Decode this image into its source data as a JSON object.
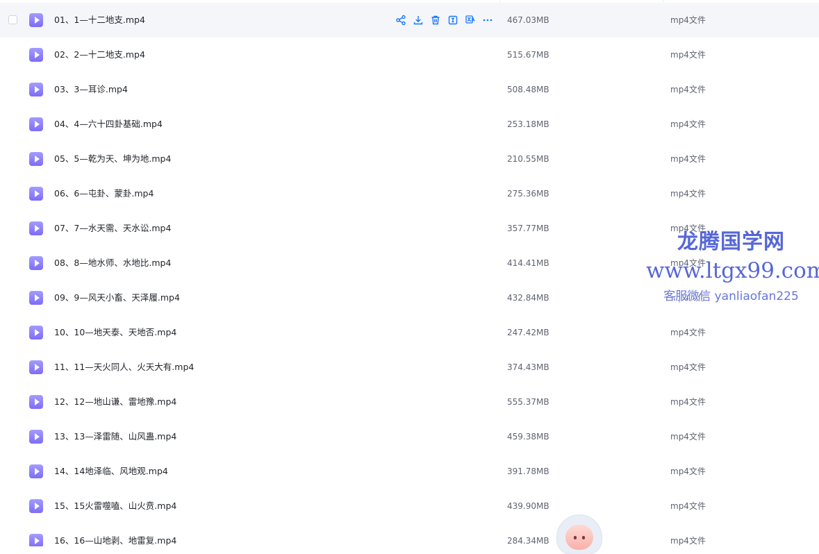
{
  "files": [
    {
      "name": "01、1—十二地支.mp4",
      "size": "467.03MB",
      "type": "mp4文件",
      "hovered": true
    },
    {
      "name": "02、2—十二地支.mp4",
      "size": "515.67MB",
      "type": "mp4文件"
    },
    {
      "name": "03、3—耳诊.mp4",
      "size": "508.48MB",
      "type": "mp4文件"
    },
    {
      "name": "04、4—六十四卦基础.mp4",
      "size": "253.18MB",
      "type": "mp4文件"
    },
    {
      "name": "05、5—乾为天、坤为地.mp4",
      "size": "210.55MB",
      "type": "mp4文件"
    },
    {
      "name": "06、6—屯卦、蒙卦.mp4",
      "size": "275.36MB",
      "type": "mp4文件"
    },
    {
      "name": "07、7—水天需、天水讼.mp4",
      "size": "357.77MB",
      "type": "mp4文件"
    },
    {
      "name": "08、8—地水师、水地比.mp4",
      "size": "414.41MB",
      "type": "mp4文件"
    },
    {
      "name": "09、9—风天小畜、天泽履.mp4",
      "size": "432.84MB",
      "type": "mp4文件"
    },
    {
      "name": "10、10—地天泰、天地否.mp4",
      "size": "247.42MB",
      "type": "mp4文件"
    },
    {
      "name": "11、11—天火同人、火天大有.mp4",
      "size": "374.43MB",
      "type": "mp4文件"
    },
    {
      "name": "12、12—地山谦、雷地豫.mp4",
      "size": "555.37MB",
      "type": "mp4文件"
    },
    {
      "name": "13、13—泽雷随、山风蛊.mp4",
      "size": "459.38MB",
      "type": "mp4文件"
    },
    {
      "name": "14、14地泽临、风地观.mp4",
      "size": "391.78MB",
      "type": "mp4文件"
    },
    {
      "name": "15、15火雷噬嗑、山火贲.mp4",
      "size": "439.90MB",
      "type": "mp4文件"
    },
    {
      "name": "16、16—山地剥、地雷复.mp4",
      "size": "284.34MB",
      "type": "mp4文件"
    }
  ],
  "row_actions": [
    {
      "icon": "share-icon"
    },
    {
      "icon": "download-icon"
    },
    {
      "icon": "delete-icon"
    },
    {
      "icon": "rename-icon"
    },
    {
      "icon": "translate-icon"
    },
    {
      "icon": "more-icon"
    }
  ],
  "watermark": {
    "title": "龙腾国学网",
    "url": "www.ltgx99.com",
    "contact": "客服微信 yanliaofan225"
  },
  "colors": {
    "accent": "#1677ff",
    "file_icon": "#8b7cf8",
    "row_hover": "#f5f6fa",
    "watermark": "#5667d6"
  }
}
